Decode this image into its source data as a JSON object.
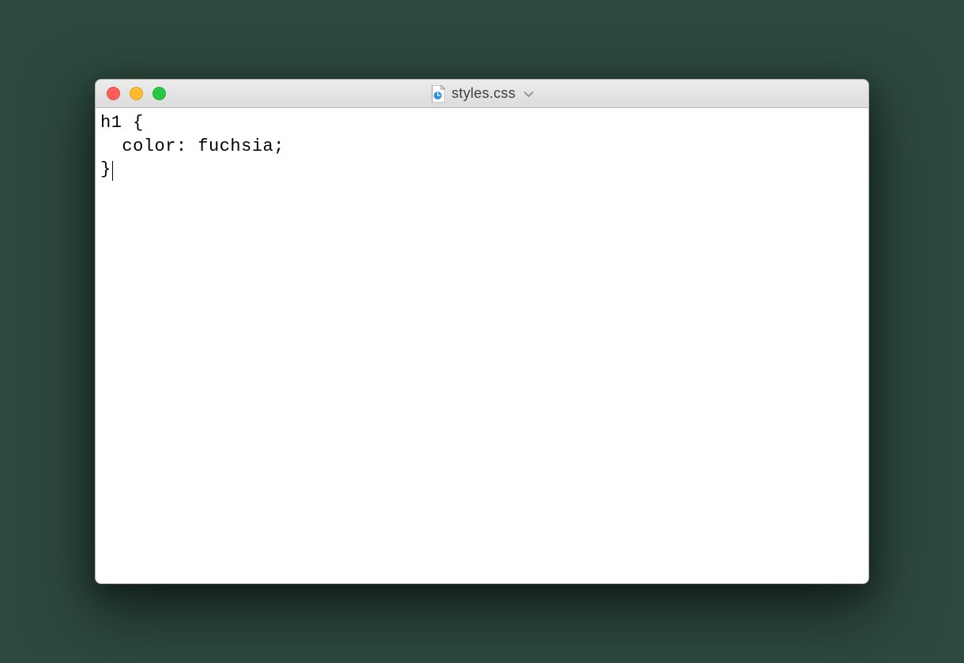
{
  "window": {
    "title": "styles.css",
    "traffic_lights": {
      "close": "close",
      "minimize": "minimize",
      "zoom": "zoom"
    }
  },
  "editor": {
    "lines": [
      "h1 {",
      "  color: fuchsia;",
      "}"
    ],
    "cursor_line_index": 2
  }
}
